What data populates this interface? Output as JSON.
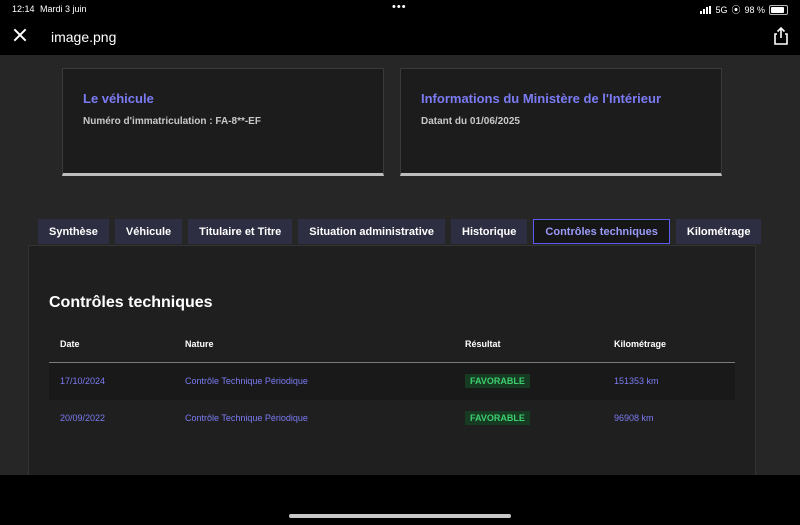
{
  "status_bar": {
    "time": "12:14",
    "date": "Mardi 3 juin",
    "network": "5G",
    "battery": "98 %"
  },
  "viewer": {
    "title": "image.png"
  },
  "cards": [
    {
      "title": "Le véhicule",
      "text": "Numéro d'immatriculation : FA-8**-EF"
    },
    {
      "title": "Informations du Ministère de l'Intérieur",
      "text": "Datant du 01/06/2025"
    }
  ],
  "tabs": [
    "Synthèse",
    "Véhicule",
    "Titulaire et Titre",
    "Situation administrative",
    "Historique",
    "Contrôles techniques",
    "Kilométrage"
  ],
  "active_tab_index": 5,
  "section": {
    "title": "Contrôles techniques",
    "columns": [
      "Date",
      "Nature",
      "Résultat",
      "Kilométrage"
    ],
    "rows": [
      {
        "date": "17/10/2024",
        "nature": "Contrôle Technique Périodique",
        "result": "FAVORABLE",
        "km": "151353 km"
      },
      {
        "date": "20/09/2022",
        "nature": "Contrôle Technique Périodique",
        "result": "FAVORABLE",
        "km": "96908 km"
      }
    ]
  },
  "colors": {
    "accent": "#7b7bf4",
    "tab_bg": "#2e2e42",
    "favorable_text": "#3ecf6e",
    "favorable_bg": "#163a22"
  },
  "icons": [
    "close-icon",
    "share-icon",
    "signal-icon",
    "battery-icon"
  ]
}
